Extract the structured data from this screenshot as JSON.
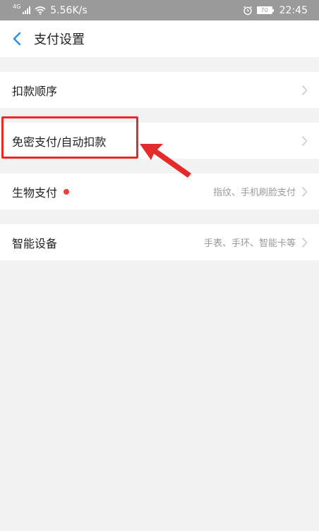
{
  "status_bar": {
    "network_tag": "4G",
    "speed": "5.56K/s",
    "battery": "70",
    "time": "22:45"
  },
  "header": {
    "title": "支付设置"
  },
  "settings": {
    "items": [
      {
        "label": "扣款顺序",
        "hint": ""
      },
      {
        "label": "免密支付/自动扣款",
        "hint": ""
      },
      {
        "label": "生物支付",
        "hint": "指纹、手机刷脸支付"
      },
      {
        "label": "智能设备",
        "hint": "手表、手环、智能卡等"
      }
    ]
  },
  "colors": {
    "accent": "#2a8de0",
    "highlight": "#e42b2b",
    "badge": "#e8423a"
  }
}
